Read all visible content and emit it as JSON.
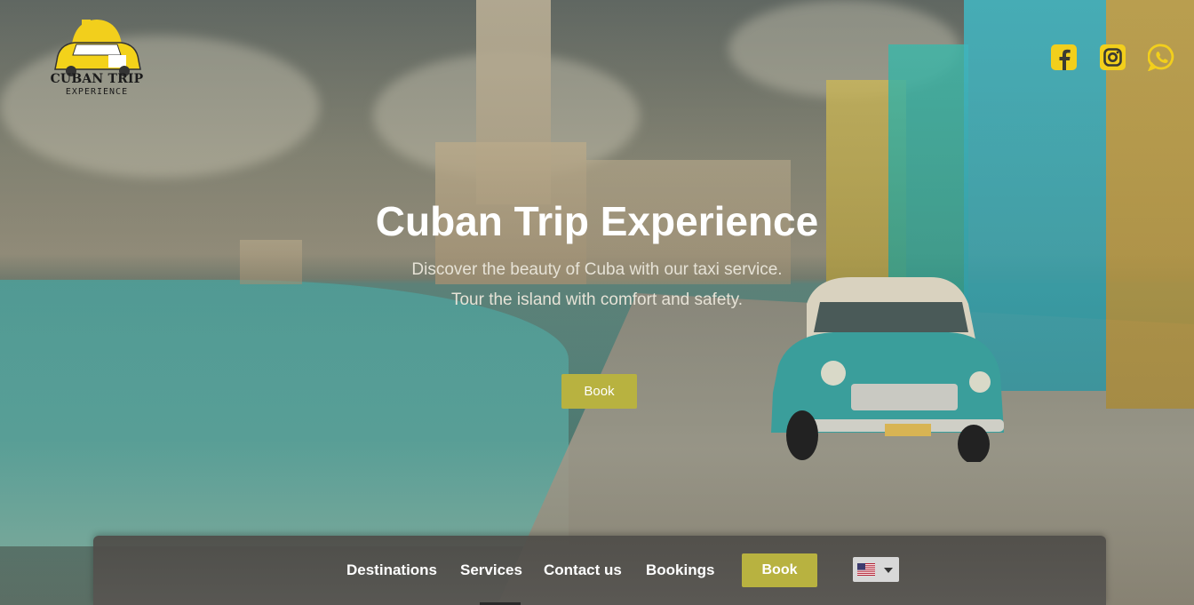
{
  "brand": {
    "logo_title": "CUBAN TRIP",
    "logo_subtitle": "EXPERIENCE"
  },
  "social": {
    "icons": [
      "facebook-icon",
      "instagram-icon",
      "whatsapp-icon"
    ],
    "color": "#f2cf1c"
  },
  "hero": {
    "title": "Cuban Trip Experience",
    "subtitle_line1": "Discover the beauty of Cuba with our taxi service.",
    "subtitle_line2": "Tour the island with comfort and safety.",
    "book_label": "Book"
  },
  "nav": {
    "items": [
      {
        "label": "Destinations"
      },
      {
        "label": "Services"
      },
      {
        "label": "Contact us"
      },
      {
        "label": "Bookings"
      }
    ],
    "book_label": "Book",
    "language": {
      "selected": "us-flag-icon"
    }
  },
  "colors": {
    "accent": "#b8b240",
    "nav_bg": "#504e4a",
    "title": "#ffffff"
  }
}
